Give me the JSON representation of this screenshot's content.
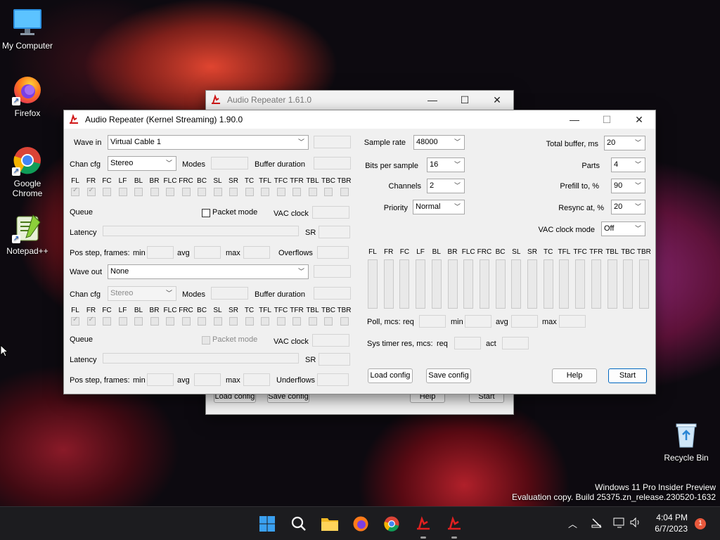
{
  "desktop": {
    "icons": [
      {
        "label": "My Computer"
      },
      {
        "label": "Firefox"
      },
      {
        "label": "Google Chrome"
      },
      {
        "label": "Notepad++"
      },
      {
        "label": "Recycle Bin"
      }
    ],
    "watermark_line1": "Windows 11 Pro Insider Preview",
    "watermark_line2": "Evaluation copy. Build 25375.zn_release.230520-1632"
  },
  "back_window": {
    "title": "Audio Repeater 1.61.0",
    "load_config": "Load config",
    "save_config": "Save config",
    "help": "Help",
    "start": "Start"
  },
  "main_window": {
    "title": "Audio Repeater (Kernel Streaming) 1.90.0",
    "minimize": "—",
    "maximize": "☐",
    "close": "✕",
    "wave_in": {
      "label": "Wave in",
      "value": "Virtual Cable 1",
      "chan_cfg_label": "Chan cfg",
      "chan_cfg_value": "Stereo",
      "modes_label": "Modes",
      "buffer_duration_label": "Buffer duration",
      "queue_label": "Queue",
      "packet_mode_label": "Packet mode",
      "vac_clock_label": "VAC clock",
      "latency_label": "Latency",
      "sr_label": "SR",
      "pos_step_label": "Pos step, frames:",
      "min_label": "min",
      "avg_label": "avg",
      "max_label": "max",
      "overflows_label": "Overflows"
    },
    "wave_out": {
      "label": "Wave out",
      "value": "None",
      "chan_cfg_label": "Chan cfg",
      "chan_cfg_value": "Stereo",
      "modes_label": "Modes",
      "buffer_duration_label": "Buffer duration",
      "queue_label": "Queue",
      "packet_mode_label": "Packet mode",
      "vac_clock_label": "VAC clock",
      "latency_label": "Latency",
      "sr_label": "SR",
      "pos_step_label": "Pos step, frames:",
      "min_label": "min",
      "avg_label": "avg",
      "max_label": "max",
      "underflows_label": "Underflows"
    },
    "channels": [
      "FL",
      "FR",
      "FC",
      "LF",
      "BL",
      "BR",
      "FLC",
      "FRC",
      "BC",
      "SL",
      "SR",
      "TC",
      "TFL",
      "TFC",
      "TFR",
      "TBL",
      "TBC",
      "TBR"
    ],
    "checked_channels": [
      "FL",
      "FR"
    ],
    "format": {
      "sample_rate_label": "Sample rate",
      "sample_rate_value": "48000",
      "bits_label": "Bits per sample",
      "bits_value": "16",
      "channels_label": "Channels",
      "channels_value": "2",
      "priority_label": "Priority",
      "priority_value": "Normal"
    },
    "buffering": {
      "total_buffer_label": "Total buffer, ms",
      "total_buffer_value": "20",
      "parts_label": "Parts",
      "parts_value": "4",
      "prefill_label": "Prefill to, %",
      "prefill_value": "90",
      "resync_label": "Resync at, %",
      "resync_value": "20",
      "vac_clock_mode_label": "VAC clock mode",
      "vac_clock_mode_value": "Off"
    },
    "levels": {
      "poll_label": "Poll, mcs:",
      "req_label": "req",
      "min_label": "min",
      "avg_label": "avg",
      "max_label": "max",
      "systimer_label": "Sys timer res, mcs:",
      "systimer_req_label": "req",
      "act_label": "act"
    },
    "buttons": {
      "load_config": "Load config",
      "save_config": "Save config",
      "help": "Help",
      "start": "Start"
    }
  },
  "taskbar": {
    "time": "4:04 PM",
    "date": "6/7/2023",
    "notification_count": "1"
  }
}
